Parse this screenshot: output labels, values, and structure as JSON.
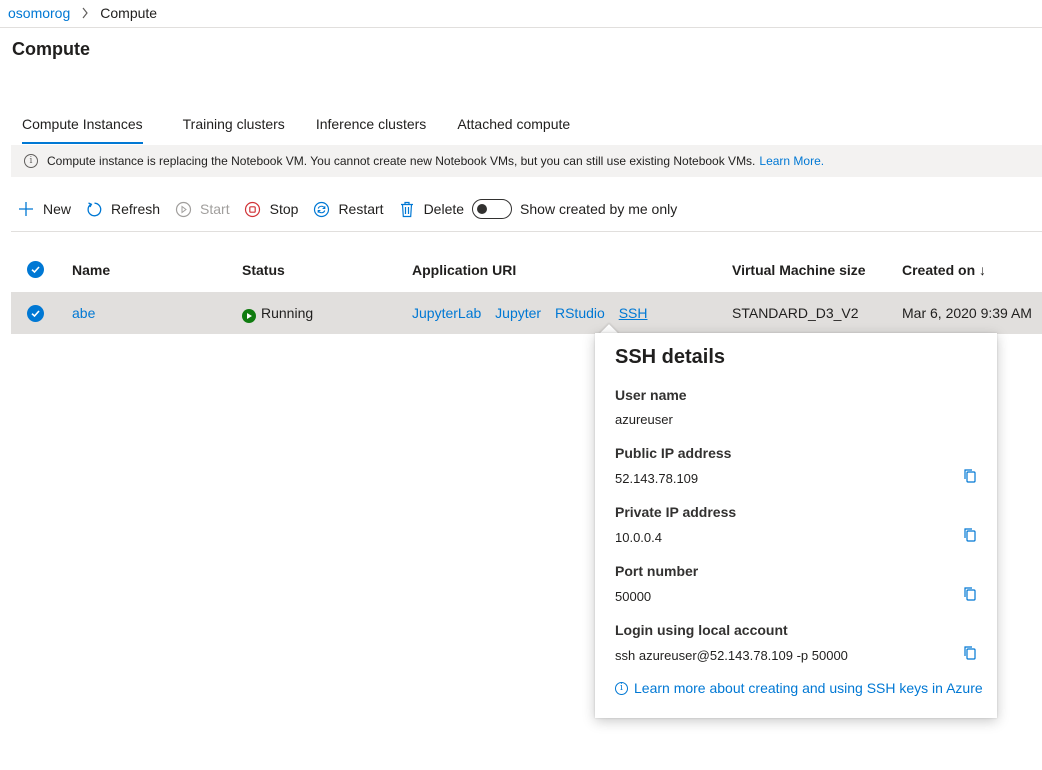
{
  "breadcrumb": {
    "workspace": "osomorog",
    "separator": ">",
    "current": "Compute"
  },
  "page": {
    "title": "Compute"
  },
  "tabs": [
    {
      "label": "Compute Instances",
      "active": true
    },
    {
      "label": "Training clusters",
      "active": false
    },
    {
      "label": "Inference clusters",
      "active": false
    },
    {
      "label": "Attached compute",
      "active": false
    }
  ],
  "banner": {
    "icon": "info-icon",
    "text": "Compute instance is replacing the Notebook VM. You cannot create new Notebook VMs, but you can still use existing Notebook VMs.",
    "link": "Learn More."
  },
  "toolbar": {
    "new": "New",
    "refresh": "Refresh",
    "start": "Start",
    "stop": "Stop",
    "restart": "Restart",
    "delete": "Delete",
    "toggle_label": "Show created by me only",
    "toggle_on": false
  },
  "table": {
    "columns": [
      "Name",
      "Status",
      "Application URI",
      "Virtual Machine size",
      "Created on ↓"
    ],
    "rows": [
      {
        "name": "abe",
        "status": "Running",
        "uris": [
          "JupyterLab",
          "Jupyter",
          "RStudio",
          "SSH"
        ],
        "vm_size": "STANDARD_D3_V2",
        "created_on": "Mar 6, 2020 9:39 AM",
        "selected": true
      }
    ]
  },
  "ssh_callout": {
    "title": "SSH details",
    "fields": [
      {
        "label": "User name",
        "value": "azureuser",
        "copyable": false
      },
      {
        "label": "Public IP address",
        "value": "52.143.78.109",
        "copyable": true
      },
      {
        "label": "Private IP address",
        "value": "10.0.0.4",
        "copyable": true
      },
      {
        "label": "Port number",
        "value": "50000",
        "copyable": true
      },
      {
        "label": "Login using local account",
        "value": "ssh azureuser@52.143.78.109 -p 50000",
        "copyable": true
      }
    ],
    "learn_more": "Learn more about creating and using SSH keys in Azure"
  },
  "colors": {
    "accent": "#0078d4",
    "running": "#107c10",
    "stop": "#d13438",
    "row_selected": "#e1dfdd",
    "banner_bg": "#f3f2f1"
  }
}
